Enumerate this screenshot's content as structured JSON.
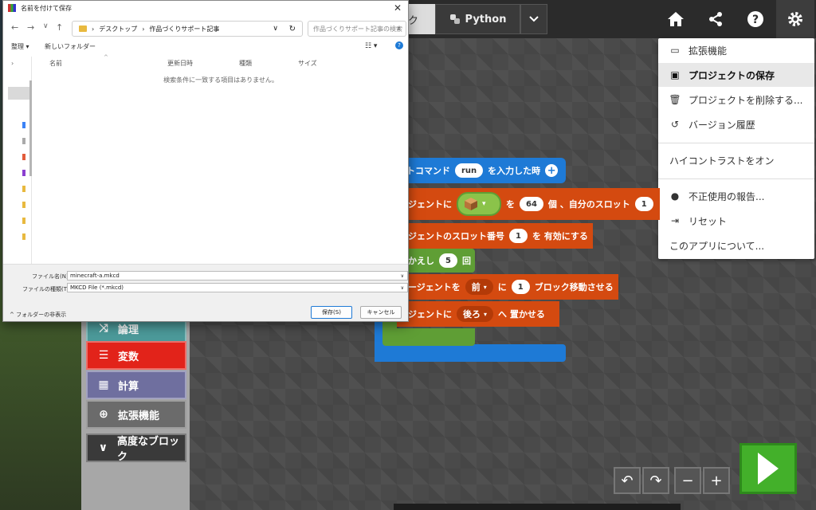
{
  "topbar": {
    "blocks_tab_partial": "ク",
    "python_tab": "Python"
  },
  "settings_menu": {
    "items": [
      {
        "label": "拡張機能",
        "icon": "drive-icon"
      },
      {
        "label": "プロジェクトの保存",
        "icon": "save-icon"
      },
      {
        "label": "プロジェクトを削除する...",
        "icon": "trash-icon"
      },
      {
        "label": "バージョン履歴",
        "icon": "history-icon"
      },
      {
        "label": "ハイコントラストをオン",
        "icon": ""
      },
      {
        "label": "不正使用の報告...",
        "icon": "alert-icon"
      },
      {
        "label": "リセット",
        "icon": "signout-icon"
      },
      {
        "label": "このアプリについて...",
        "icon": ""
      }
    ]
  },
  "toolbox": {
    "categories": [
      {
        "label": "論理",
        "color": "#4c9a9a"
      },
      {
        "label": "変数",
        "color": "#e2231a"
      },
      {
        "label": "計算",
        "color": "#6f6f9f"
      },
      {
        "label": "拡張機能",
        "color": "#6b6b6b"
      },
      {
        "label": "高度なブロック",
        "color": "#3a3a3a"
      }
    ]
  },
  "blocks": {
    "chat_command": {
      "prefix": "トコマンド",
      "value": "run",
      "suffix": "を入力した時"
    },
    "agent_set_item": {
      "prefix": "ジェントに",
      "mid1": "を",
      "count": "64",
      "mid2": "個 、自分のスロット",
      "slot": "1"
    },
    "agent_set_slot": {
      "prefix": "ジェントのスロット番号",
      "value": "1",
      "suffix": "を 有効にする"
    },
    "repeat": {
      "prefix": "かえし",
      "value": "5",
      "suffix": "回"
    },
    "agent_move": {
      "prefix": "ージェントを",
      "dir": "前",
      "mid": "に",
      "value": "1",
      "suffix": "ブロック移動させる"
    },
    "agent_place": {
      "prefix": "ジェントに",
      "dir": "後ろ",
      "suffix": "へ 置かせる"
    }
  },
  "dialog": {
    "title": "名前を付けて保存",
    "breadcrumb": [
      "デスクトップ",
      "作品づくりサポート記事"
    ],
    "search_placeholder": "作品づくりサポート記事の検索",
    "toolbar_organize": "整理 ▾",
    "toolbar_new_folder": "新しいフォルダー",
    "columns": [
      "名前",
      "更新日時",
      "種類",
      "サイズ"
    ],
    "empty_message": "検索条件に一致する項目はありません。",
    "filename_label": "ファイル名(N):",
    "filename_value": "minecraft-a.mkcd",
    "filetype_label": "ファイルの種類(T):",
    "filetype_value": "MKCD File (*.mkcd)",
    "hide_folders": "フォルダーの非表示",
    "save_button": "保存(S)",
    "cancel_button": "キャンセル"
  }
}
